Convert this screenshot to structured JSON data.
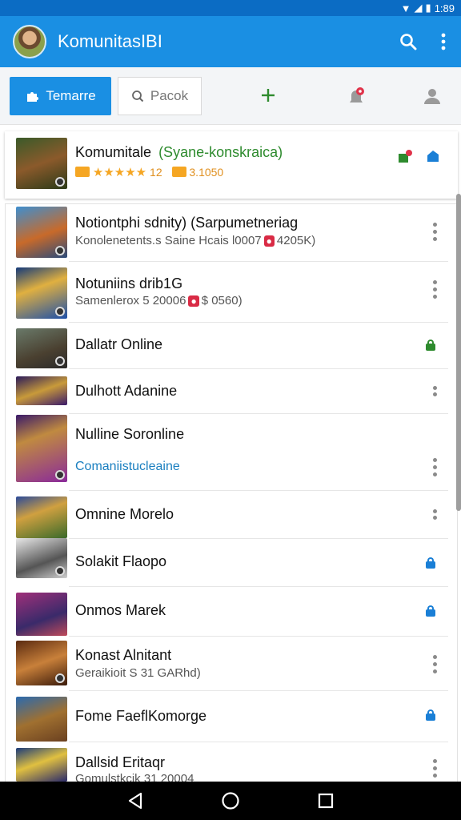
{
  "status_bar": {
    "time": "1:89"
  },
  "app_bar": {
    "title": "KomunitasIBI"
  },
  "toolbar": {
    "tab_label": "Temarre",
    "search_placeholder": "Pacok"
  },
  "featured": {
    "title": "Komumitale",
    "title_tag": "(Syane-konskraica)",
    "rating_prefix": "12",
    "rating_count": "3.1050",
    "stars": "★★★★★"
  },
  "items": [
    {
      "title": "Notiontphi sdnity) (Sarpumetneriag",
      "subtitle": "Konolenetents.s Saine Hcais l0007",
      "badge": "●",
      "extra": "4205K)",
      "action": "more"
    },
    {
      "title": "Notuniins drib1G",
      "subtitle": "Samenlerox 5 20006",
      "badge": "●",
      "extra": "$ 0560)",
      "action": "more"
    },
    {
      "title": "Dallatr Online",
      "subtitle": "",
      "action": "lock-green"
    },
    {
      "title": "Dulhott Adanine",
      "subtitle": "",
      "action": "more-small"
    },
    {
      "title": "Nulline Soronline",
      "subtitle": "Comaniistucleaine",
      "action": "more"
    },
    {
      "title": "Omnine Morelo",
      "subtitle": "",
      "action": "more-small"
    },
    {
      "title": "Solakit Flaopo",
      "subtitle": "",
      "action": "lock-blue"
    },
    {
      "title": "Onmos Marek",
      "subtitle": "",
      "action": "lock-blue"
    },
    {
      "title": "Konast Alnitant",
      "subtitle": "Geraikioit S 31 GARhd)",
      "action": "more"
    },
    {
      "title": "Fome FaeflKomorge",
      "subtitle": "",
      "action": "lock-blue"
    },
    {
      "title": "Dallsid Eritaqr",
      "subtitle": "Gomulstkcik 31 20004",
      "action": "more"
    }
  ],
  "colors": {
    "primary": "#1a8fe3",
    "accent_green": "#2e8b2e",
    "star": "#f5a623",
    "badge_red": "#d92b45"
  }
}
